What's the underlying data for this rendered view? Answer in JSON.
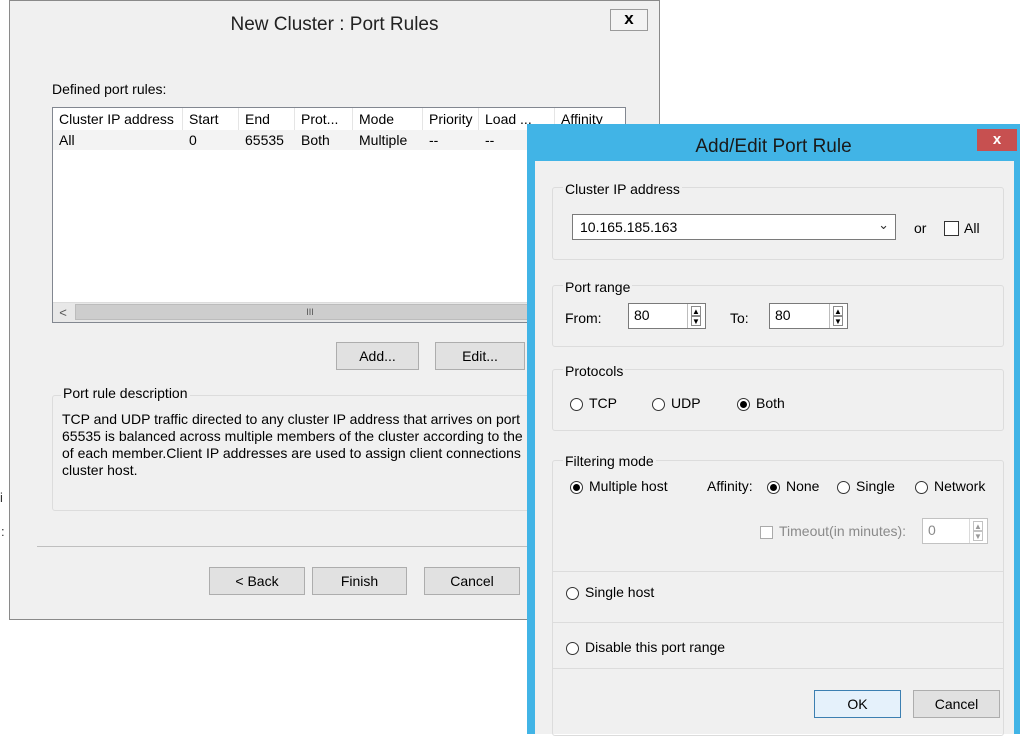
{
  "cluster_dialog": {
    "title": "New Cluster :  Port Rules",
    "close_glyph": "x",
    "defined_rules_label": "Defined port rules:",
    "columns": [
      "Cluster IP address",
      "Start",
      "End",
      "Prot...",
      "Mode",
      "Priority",
      "Load ...",
      "Affinity"
    ],
    "rows": [
      [
        "All",
        "0",
        "65535",
        "Both",
        "Multiple",
        "--",
        "--",
        ""
      ]
    ],
    "scroll_left": "<",
    "scroll_thumb": "III",
    "add_label": "Add...",
    "edit_label": "Edit...",
    "description_title": "Port rule description",
    "description_lines": [
      "TCP and UDP traffic directed to any cluster IP address that arrives on port",
      "65535 is balanced across multiple members of the cluster according to the",
      "of each member.Client IP addresses are used to assign client connections",
      "cluster host."
    ],
    "back_label": "< Back",
    "finish_label": "Finish",
    "cancel_label": "Cancel"
  },
  "edit_dialog": {
    "title": "Add/Edit Port Rule",
    "close_glyph": "x",
    "cluster_ip_group": "Cluster IP address",
    "cluster_ip_value": "10.165.185.163",
    "or_label": "or",
    "all_label": "All",
    "port_range_group": "Port range",
    "from_label": "From:",
    "from_value": "80",
    "to_label": "To:",
    "to_value": "80",
    "protocols_group": "Protocols",
    "protocol_tcp": "TCP",
    "protocol_udp": "UDP",
    "protocol_both": "Both",
    "selected_protocol": "Both",
    "filtering_group": "Filtering mode",
    "multiple_host_label": "Multiple host",
    "affinity_label": "Affinity:",
    "affinity_none": "None",
    "affinity_single": "Single",
    "affinity_network": "Network",
    "selected_affinity": "None",
    "timeout_label": "Timeout(in minutes):",
    "timeout_value": "0",
    "single_host_label": "Single host",
    "disable_label": "Disable this port range",
    "ok_label": "OK",
    "cancel_label": "Cancel"
  },
  "background_glyphs": [
    "i",
    ":"
  ],
  "colors": {
    "accent": "#41b4e6",
    "close_red": "#c75050",
    "dialog_bg": "#f0f0f0",
    "list_selected": "#f0f0f0"
  }
}
